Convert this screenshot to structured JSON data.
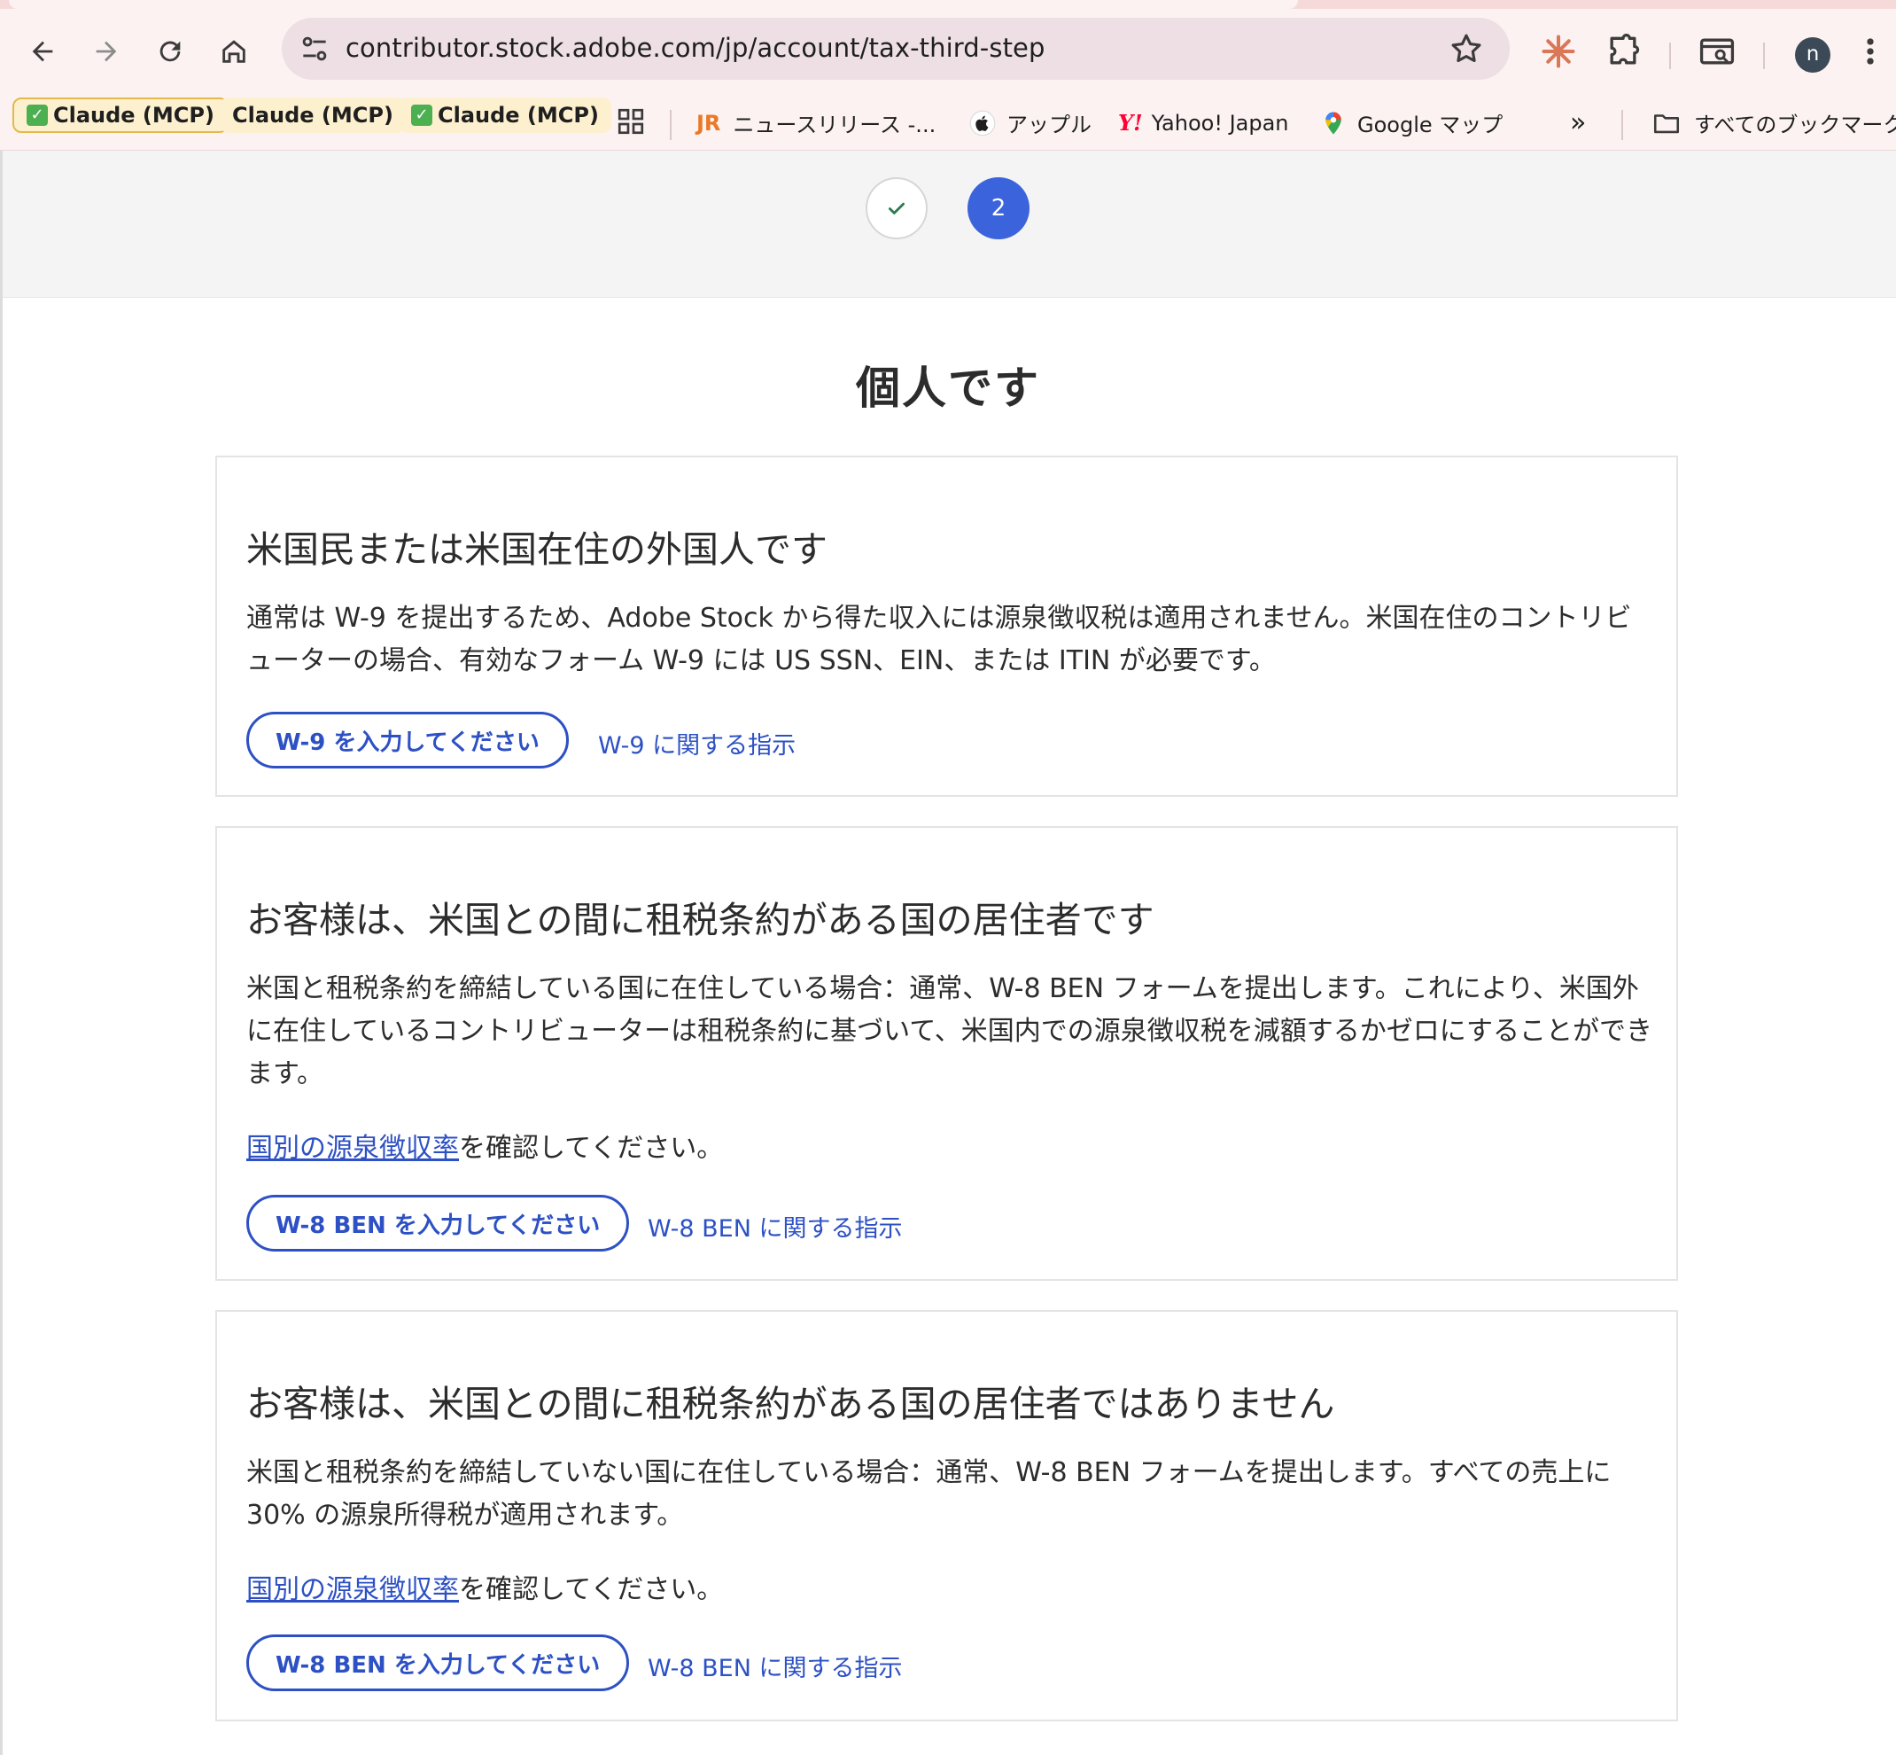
{
  "browser": {
    "url": "contributor.stock.adobe.com/jp/account/tax-third-step",
    "avatar_letter": "n",
    "bookmarks": [
      {
        "label": "Claude (MCP)"
      },
      {
        "label": "Claude (MCP)"
      },
      {
        "label": "Claude (MCP)"
      },
      {
        "label": "ニュースリリース -..."
      },
      {
        "label": "アップル"
      },
      {
        "label": "Yahoo! Japan"
      },
      {
        "label": "Google マップ"
      },
      {
        "label": "すべてのブックマーク"
      }
    ],
    "overflow_label": "»"
  },
  "stepper": {
    "current_step": "2"
  },
  "page": {
    "title": "個人です",
    "cards": [
      {
        "title": "米国民または米国在住の外国人です",
        "description": "通常は W-9 を提出するため、Adobe Stock から得た収入には源泉徴収税は適用されません。米国在住のコントリビューターの場合、有効なフォーム W-9 には US SSN、EIN、または ITIN が必要です。",
        "button": "W-9 を入力してください",
        "instructions": "W-9 に関する指示"
      },
      {
        "title": "お客様は、米国との間に租税条約がある国の居住者です",
        "description": "米国と租税条約を締結している国に在住している場合：通常、W-8 BEN フォームを提出します。これにより、米国外に在住しているコントリビューターは租税条約に基づいて、米国内での源泉徴収税を減額するかゼロにすることができます。",
        "rate_link": "国別の源泉徴収率",
        "rate_suffix": "を確認してください。",
        "button": "W-8 BEN を入力してください",
        "instructions": "W-8 BEN に関する指示"
      },
      {
        "title": "お客様は、米国との間に租税条約がある国の居住者ではありません",
        "description": "米国と租税条約を締結していない国に在住している場合：通常、W-8 BEN フォームを提出します。すべての売上に 30% の源泉所得税が適用されます。",
        "rate_link": "国別の源泉徴収率",
        "rate_suffix": "を確認してください。",
        "button": "W-8 BEN を入力してください",
        "instructions": "W-8 BEN に関する指示"
      }
    ]
  },
  "colors": {
    "accent": "#2d51c4",
    "step_active": "#3b63db",
    "chrome_bg": "#fdf2f2"
  }
}
